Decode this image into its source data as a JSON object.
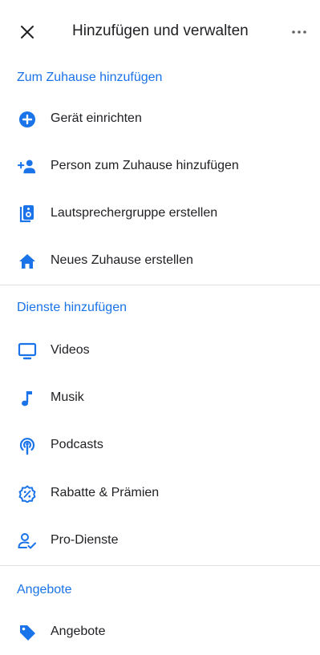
{
  "appbar": {
    "title": "Hinzufügen und verwalten",
    "close_icon": "close-icon",
    "more_icon": "more-horizontal-icon"
  },
  "sections": [
    {
      "header": "Zum Zuhause hinzufügen",
      "items": [
        {
          "label": "Gerät einrichten",
          "icon": "add-circle-icon"
        },
        {
          "label": "Person zum Zuhause hinzufügen",
          "icon": "person-add-icon"
        },
        {
          "label": "Lautsprechergruppe erstellen",
          "icon": "speaker-group-icon"
        },
        {
          "label": "Neues Zuhause erstellen",
          "icon": "home-icon"
        }
      ]
    },
    {
      "header": "Dienste hinzufügen",
      "items": [
        {
          "label": "Videos",
          "icon": "tv-icon"
        },
        {
          "label": "Musik",
          "icon": "music-note-icon"
        },
        {
          "label": "Podcasts",
          "icon": "podcast-icon"
        },
        {
          "label": "Rabatte & Prämien",
          "icon": "discount-badge-icon"
        },
        {
          "label": "Pro-Dienste",
          "icon": "pro-services-icon"
        }
      ]
    },
    {
      "header": "Angebote",
      "items": [
        {
          "label": "Angebote",
          "icon": "tag-icon"
        }
      ]
    }
  ],
  "colors": {
    "accent": "#1a73e8",
    "text": "#202124",
    "divider": "#e0e0e0"
  }
}
